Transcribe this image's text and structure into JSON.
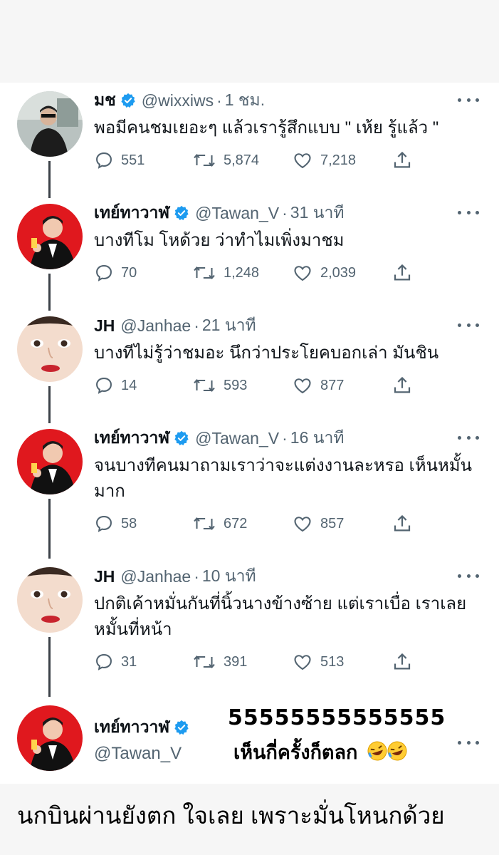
{
  "colors": {
    "verified": "#1d9bf0",
    "muted": "#536471",
    "text": "#0f1419",
    "thread_line": "#3b4148"
  },
  "tweets": [
    {
      "name": "มช",
      "verified": true,
      "handle": "@wixxiws",
      "time": "1 ชม.",
      "text": "พอมีคนชมเยอะๆ แล้วเรารู้สึกแบบ \" เห้ย รู้แล้ว \"",
      "replies": "551",
      "retweets": "5,874",
      "likes": "7,218"
    },
    {
      "name": "เทย์ทาวาฬ",
      "verified": true,
      "handle": "@Tawan_V",
      "time": "31 นาที",
      "text": "บางทีโม โหด้วย ว่าทำไมเพิ่งมาชม",
      "replies": "70",
      "retweets": "1,248",
      "likes": "2,039"
    },
    {
      "name": "JH",
      "verified": false,
      "handle": "@Janhae",
      "time": "21 นาที",
      "text": "บางทีไม่รู้ว่าชมอะ นึกว่าประโยคบอกเล่า มันชิน",
      "replies": "14",
      "retweets": "593",
      "likes": "877"
    },
    {
      "name": "เทย์ทาวาฬ",
      "verified": true,
      "handle": "@Tawan_V",
      "time": "16 นาที",
      "text": "จนบางทีคนมาถามเราว่าจะแต่งงานละหรอ เห็นหมั้นมาก",
      "replies": "58",
      "retweets": "672",
      "likes": "857"
    },
    {
      "name": "JH",
      "verified": false,
      "handle": "@Janhae",
      "time": "10 นาที",
      "text": "ปกติเค้าหมั่นกันที่นิ้วนางข้างซ้าย แต่เราเบื่อ เราเลยหมั้นที่หน้า",
      "replies": "31",
      "retweets": "391",
      "likes": "513"
    },
    {
      "name": "เทย์ทาวาฬ",
      "verified": true,
      "handle": "@Tawan_V"
    }
  ],
  "sticker": {
    "line1": "55555555555555",
    "line2": "เห็นกี่ครั้งก็ตลก"
  },
  "caption": "นกบินผ่านยังตก ใจเลย เพราะมั่นโหนกด้วย",
  "icons": [
    "reply-icon",
    "retweet-icon",
    "like-icon",
    "share-icon",
    "verified-icon",
    "more-icon",
    "laughing-emoji"
  ]
}
